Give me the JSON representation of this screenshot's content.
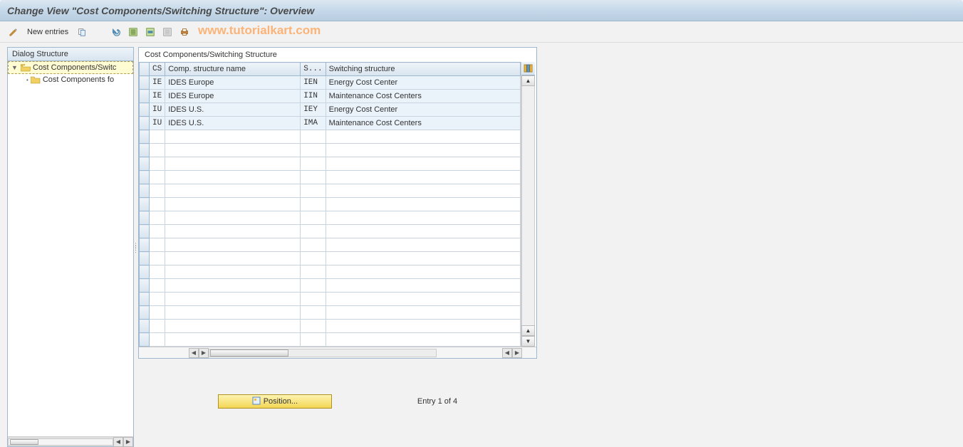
{
  "title": "Change View \"Cost Components/Switching Structure\": Overview",
  "toolbar": {
    "new_entries": "New entries"
  },
  "watermark": "www.tutorialkart.com",
  "sidebar": {
    "header": "Dialog Structure",
    "items": [
      {
        "label": "Cost Components/Switc",
        "selected": true,
        "level": 0
      },
      {
        "label": "Cost Components fo",
        "selected": false,
        "level": 1
      }
    ]
  },
  "table": {
    "title": "Cost Components/Switching Structure",
    "columns": {
      "rowselector": "",
      "cs": "CS",
      "csname": "Comp. structure name",
      "s": "S...",
      "ss": "Switching structure"
    },
    "rows": [
      {
        "cs": "IE",
        "csname": "IDES Europe",
        "s": "IEN",
        "ss": "Energy Cost Center"
      },
      {
        "cs": "IE",
        "csname": "IDES Europe",
        "s": "IIN",
        "ss": "Maintenance Cost Centers"
      },
      {
        "cs": "IU",
        "csname": "IDES U.S.",
        "s": "IEY",
        "ss": "Energy Cost Center"
      },
      {
        "cs": "IU",
        "csname": "IDES U.S.",
        "s": "IMA",
        "ss": "Maintenance Cost Centers"
      }
    ],
    "empty_rows": 16
  },
  "footer": {
    "position_label": "Position...",
    "entry_text": "Entry 1 of 4"
  }
}
